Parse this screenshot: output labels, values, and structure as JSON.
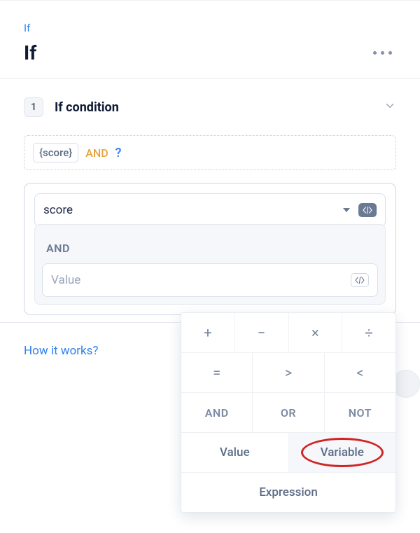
{
  "header": {
    "crumb": "If",
    "title": "If"
  },
  "step": {
    "number": "1",
    "title": "If condition"
  },
  "expression_preview": {
    "token": "{score}",
    "operator": "AND",
    "placeholder": "?"
  },
  "editor": {
    "field1_value": "score",
    "mid_operator": "AND",
    "field2_placeholder": "Value"
  },
  "footer": {
    "how_link": "How it works?"
  },
  "picker": {
    "ops_math": [
      "+",
      "−",
      "×",
      "÷"
    ],
    "ops_cmp": [
      "=",
      ">",
      "<"
    ],
    "ops_bool": [
      "AND",
      "OR",
      "NOT"
    ],
    "valvar": [
      "Value",
      "Variable"
    ],
    "expr": "Expression"
  }
}
